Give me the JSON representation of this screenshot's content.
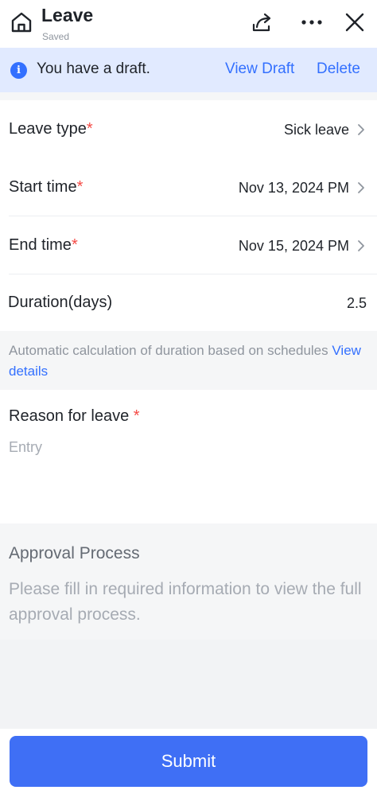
{
  "header": {
    "title": "Leave",
    "subtitle": "Saved",
    "icons": [
      "home-icon",
      "share-icon",
      "more-icon",
      "close-icon"
    ]
  },
  "draft_banner": {
    "message": "You have a draft.",
    "view_draft": "View Draft",
    "delete": "Delete",
    "info_glyph": "i"
  },
  "form": {
    "leave_type": {
      "label": "Leave type",
      "required": "*",
      "value": "Sick leave"
    },
    "start_time": {
      "label": "Start time",
      "required": "*",
      "value": "Nov 13, 2024 PM"
    },
    "end_time": {
      "label": "End time",
      "required": "*",
      "value": "Nov 15, 2024 PM"
    },
    "duration": {
      "label": "Duration(days)",
      "value": "2.5"
    },
    "auto_note": {
      "text": "Automatic calculation of duration based on schedules",
      "link": "View details"
    },
    "reason": {
      "label": "Reason for leave",
      "required": "*",
      "placeholder": "Entry"
    }
  },
  "approval": {
    "heading": "Approval Process",
    "description": "Please fill in required information to view the full approval process."
  },
  "footer": {
    "submit": "Submit"
  },
  "colors": {
    "accent": "#3370ff",
    "submit": "#3f6ff5",
    "required": "#f54a45",
    "banner_bg": "#e1eaff"
  }
}
